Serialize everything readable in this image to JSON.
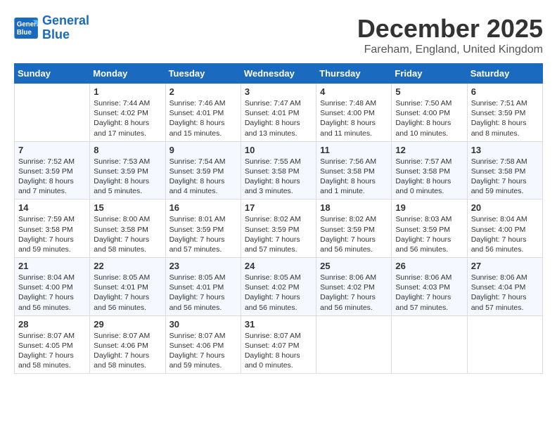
{
  "header": {
    "logo_line1": "General",
    "logo_line2": "Blue",
    "month": "December 2025",
    "location": "Fareham, England, United Kingdom"
  },
  "days_of_week": [
    "Sunday",
    "Monday",
    "Tuesday",
    "Wednesday",
    "Thursday",
    "Friday",
    "Saturday"
  ],
  "weeks": [
    [
      {
        "day": "",
        "info": ""
      },
      {
        "day": "1",
        "info": "Sunrise: 7:44 AM\nSunset: 4:02 PM\nDaylight: 8 hours\nand 17 minutes."
      },
      {
        "day": "2",
        "info": "Sunrise: 7:46 AM\nSunset: 4:01 PM\nDaylight: 8 hours\nand 15 minutes."
      },
      {
        "day": "3",
        "info": "Sunrise: 7:47 AM\nSunset: 4:01 PM\nDaylight: 8 hours\nand 13 minutes."
      },
      {
        "day": "4",
        "info": "Sunrise: 7:48 AM\nSunset: 4:00 PM\nDaylight: 8 hours\nand 11 minutes."
      },
      {
        "day": "5",
        "info": "Sunrise: 7:50 AM\nSunset: 4:00 PM\nDaylight: 8 hours\nand 10 minutes."
      },
      {
        "day": "6",
        "info": "Sunrise: 7:51 AM\nSunset: 3:59 PM\nDaylight: 8 hours\nand 8 minutes."
      }
    ],
    [
      {
        "day": "7",
        "info": "Sunrise: 7:52 AM\nSunset: 3:59 PM\nDaylight: 8 hours\nand 7 minutes."
      },
      {
        "day": "8",
        "info": "Sunrise: 7:53 AM\nSunset: 3:59 PM\nDaylight: 8 hours\nand 5 minutes."
      },
      {
        "day": "9",
        "info": "Sunrise: 7:54 AM\nSunset: 3:59 PM\nDaylight: 8 hours\nand 4 minutes."
      },
      {
        "day": "10",
        "info": "Sunrise: 7:55 AM\nSunset: 3:58 PM\nDaylight: 8 hours\nand 3 minutes."
      },
      {
        "day": "11",
        "info": "Sunrise: 7:56 AM\nSunset: 3:58 PM\nDaylight: 8 hours\nand 1 minute."
      },
      {
        "day": "12",
        "info": "Sunrise: 7:57 AM\nSunset: 3:58 PM\nDaylight: 8 hours\nand 0 minutes."
      },
      {
        "day": "13",
        "info": "Sunrise: 7:58 AM\nSunset: 3:58 PM\nDaylight: 7 hours\nand 59 minutes."
      }
    ],
    [
      {
        "day": "14",
        "info": "Sunrise: 7:59 AM\nSunset: 3:58 PM\nDaylight: 7 hours\nand 59 minutes."
      },
      {
        "day": "15",
        "info": "Sunrise: 8:00 AM\nSunset: 3:58 PM\nDaylight: 7 hours\nand 58 minutes."
      },
      {
        "day": "16",
        "info": "Sunrise: 8:01 AM\nSunset: 3:59 PM\nDaylight: 7 hours\nand 57 minutes."
      },
      {
        "day": "17",
        "info": "Sunrise: 8:02 AM\nSunset: 3:59 PM\nDaylight: 7 hours\nand 57 minutes."
      },
      {
        "day": "18",
        "info": "Sunrise: 8:02 AM\nSunset: 3:59 PM\nDaylight: 7 hours\nand 56 minutes."
      },
      {
        "day": "19",
        "info": "Sunrise: 8:03 AM\nSunset: 3:59 PM\nDaylight: 7 hours\nand 56 minutes."
      },
      {
        "day": "20",
        "info": "Sunrise: 8:04 AM\nSunset: 4:00 PM\nDaylight: 7 hours\nand 56 minutes."
      }
    ],
    [
      {
        "day": "21",
        "info": "Sunrise: 8:04 AM\nSunset: 4:00 PM\nDaylight: 7 hours\nand 56 minutes."
      },
      {
        "day": "22",
        "info": "Sunrise: 8:05 AM\nSunset: 4:01 PM\nDaylight: 7 hours\nand 56 minutes."
      },
      {
        "day": "23",
        "info": "Sunrise: 8:05 AM\nSunset: 4:01 PM\nDaylight: 7 hours\nand 56 minutes."
      },
      {
        "day": "24",
        "info": "Sunrise: 8:05 AM\nSunset: 4:02 PM\nDaylight: 7 hours\nand 56 minutes."
      },
      {
        "day": "25",
        "info": "Sunrise: 8:06 AM\nSunset: 4:02 PM\nDaylight: 7 hours\nand 56 minutes."
      },
      {
        "day": "26",
        "info": "Sunrise: 8:06 AM\nSunset: 4:03 PM\nDaylight: 7 hours\nand 57 minutes."
      },
      {
        "day": "27",
        "info": "Sunrise: 8:06 AM\nSunset: 4:04 PM\nDaylight: 7 hours\nand 57 minutes."
      }
    ],
    [
      {
        "day": "28",
        "info": "Sunrise: 8:07 AM\nSunset: 4:05 PM\nDaylight: 7 hours\nand 58 minutes."
      },
      {
        "day": "29",
        "info": "Sunrise: 8:07 AM\nSunset: 4:06 PM\nDaylight: 7 hours\nand 58 minutes."
      },
      {
        "day": "30",
        "info": "Sunrise: 8:07 AM\nSunset: 4:06 PM\nDaylight: 7 hours\nand 59 minutes."
      },
      {
        "day": "31",
        "info": "Sunrise: 8:07 AM\nSunset: 4:07 PM\nDaylight: 8 hours\nand 0 minutes."
      },
      {
        "day": "",
        "info": ""
      },
      {
        "day": "",
        "info": ""
      },
      {
        "day": "",
        "info": ""
      }
    ]
  ]
}
